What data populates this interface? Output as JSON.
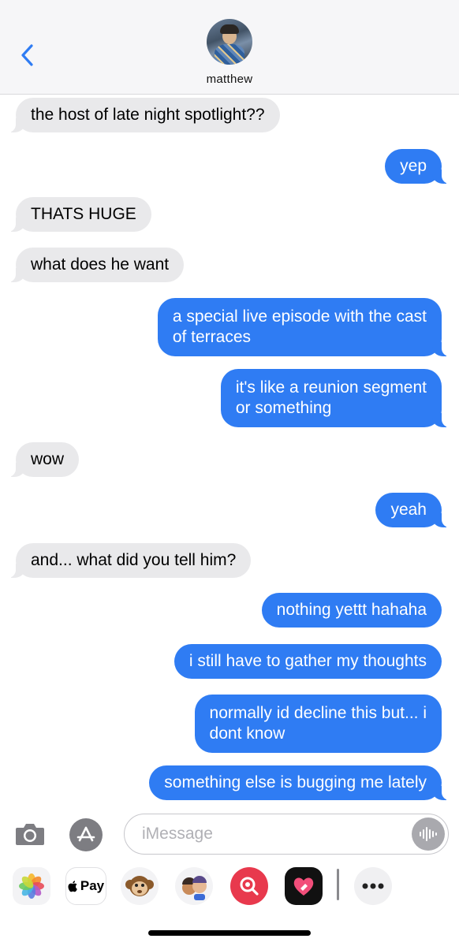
{
  "header": {
    "contact_name": "matthew",
    "back_icon": "chevron-left-icon",
    "avatar_icon": "contact-photo"
  },
  "messages": [
    {
      "from": "in",
      "text": "the host of late night spotlight??"
    },
    {
      "from": "out",
      "text": "yep"
    },
    {
      "from": "in",
      "text": "THATS HUGE"
    },
    {
      "from": "in",
      "text": "what does he want"
    },
    {
      "from": "out",
      "lines": [
        "a special live episode with the cast",
        "of terraces"
      ]
    },
    {
      "from": "out",
      "lines": [
        "it's like a reunion segment",
        "or something"
      ]
    },
    {
      "from": "in",
      "text": "wow"
    },
    {
      "from": "out",
      "text": "yeah"
    },
    {
      "from": "in",
      "text": "and... what did you tell him?"
    },
    {
      "from": "out",
      "text": "nothing yettt hahaha"
    },
    {
      "from": "out",
      "text": "i still have to gather my thoughts"
    },
    {
      "from": "out",
      "lines": [
        "normally id decline this but... i",
        "dont know"
      ]
    },
    {
      "from": "out",
      "text": "something else is bugging me lately"
    }
  ],
  "input": {
    "placeholder": "iMessage",
    "camera_icon": "camera-icon",
    "appstore_icon": "app-store-icon",
    "audio_icon": "audio-waveform-icon"
  },
  "drawer": {
    "pay_label": "Pay",
    "apps": [
      "photos-icon",
      "apple-pay-icon",
      "monkey-memoji-icon",
      "memoji-stickers-icon",
      "image-search-icon",
      "digital-touch-icon",
      "more-icon"
    ]
  },
  "colors": {
    "outgoing": "#2f7cf3",
    "incoming": "#e9e9eb",
    "accent": "#2f7cf3"
  }
}
